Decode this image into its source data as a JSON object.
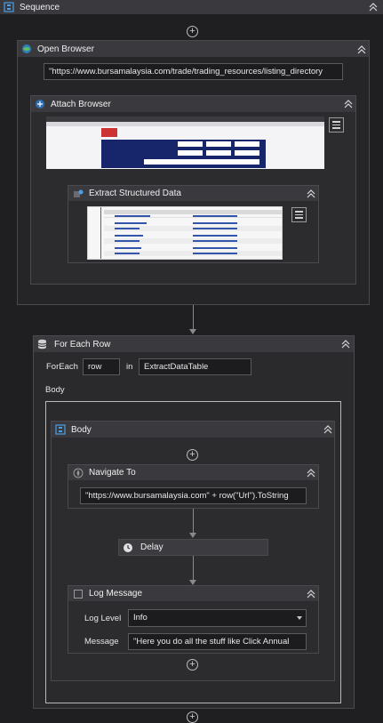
{
  "sequence": {
    "title": "Sequence"
  },
  "open_browser": {
    "title": "Open Browser",
    "url": "\"https://www.bursamalaysia.com/trade/trading_resources/listing_directory"
  },
  "attach_browser": {
    "title": "Attach Browser"
  },
  "extract_data": {
    "title": "Extract Structured Data"
  },
  "for_each_row": {
    "title": "For Each Row",
    "foreach_label": "ForEach",
    "item_var": "row",
    "in_label": "in",
    "collection": "ExtractDataTable",
    "body_label": "Body"
  },
  "body": {
    "title": "Body"
  },
  "navigate_to": {
    "title": "Navigate To",
    "url_expr": "\"https://www.bursamalaysia.com\" + row(\"Url\").ToString"
  },
  "delay": {
    "title": "Delay"
  },
  "log_message": {
    "title": "Log Message",
    "level_label": "Log Level",
    "level_value": "Info",
    "message_label": "Message",
    "message_value": "\"Here you do all the stuff like Click Annual"
  }
}
